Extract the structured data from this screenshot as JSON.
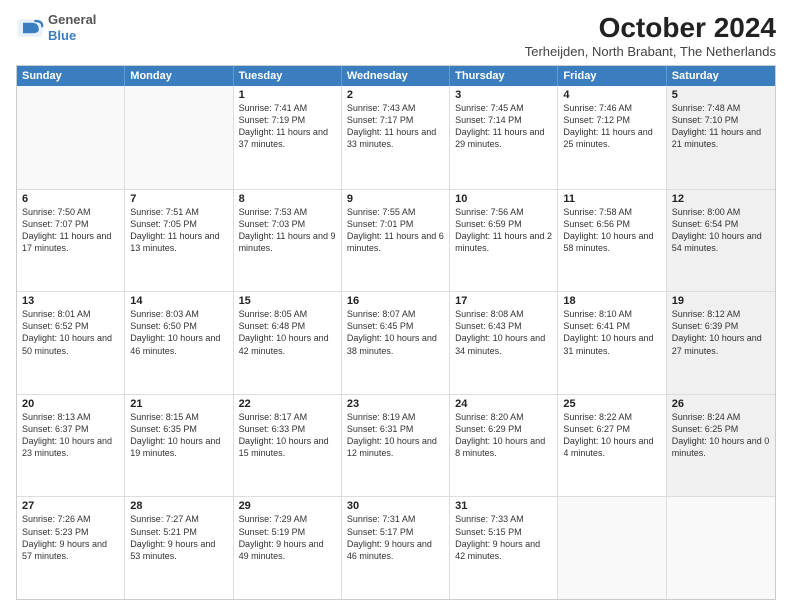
{
  "logo": {
    "line1": "General",
    "line2": "Blue"
  },
  "title": "October 2024",
  "subtitle": "Terheijden, North Brabant, The Netherlands",
  "header_days": [
    "Sunday",
    "Monday",
    "Tuesday",
    "Wednesday",
    "Thursday",
    "Friday",
    "Saturday"
  ],
  "weeks": [
    [
      {
        "day": "",
        "sunrise": "",
        "sunset": "",
        "daylight": "",
        "shaded": false,
        "empty": true
      },
      {
        "day": "",
        "sunrise": "",
        "sunset": "",
        "daylight": "",
        "shaded": false,
        "empty": true
      },
      {
        "day": "1",
        "sunrise": "Sunrise: 7:41 AM",
        "sunset": "Sunset: 7:19 PM",
        "daylight": "Daylight: 11 hours and 37 minutes.",
        "shaded": false,
        "empty": false
      },
      {
        "day": "2",
        "sunrise": "Sunrise: 7:43 AM",
        "sunset": "Sunset: 7:17 PM",
        "daylight": "Daylight: 11 hours and 33 minutes.",
        "shaded": false,
        "empty": false
      },
      {
        "day": "3",
        "sunrise": "Sunrise: 7:45 AM",
        "sunset": "Sunset: 7:14 PM",
        "daylight": "Daylight: 11 hours and 29 minutes.",
        "shaded": false,
        "empty": false
      },
      {
        "day": "4",
        "sunrise": "Sunrise: 7:46 AM",
        "sunset": "Sunset: 7:12 PM",
        "daylight": "Daylight: 11 hours and 25 minutes.",
        "shaded": false,
        "empty": false
      },
      {
        "day": "5",
        "sunrise": "Sunrise: 7:48 AM",
        "sunset": "Sunset: 7:10 PM",
        "daylight": "Daylight: 11 hours and 21 minutes.",
        "shaded": true,
        "empty": false
      }
    ],
    [
      {
        "day": "6",
        "sunrise": "Sunrise: 7:50 AM",
        "sunset": "Sunset: 7:07 PM",
        "daylight": "Daylight: 11 hours and 17 minutes.",
        "shaded": false,
        "empty": false
      },
      {
        "day": "7",
        "sunrise": "Sunrise: 7:51 AM",
        "sunset": "Sunset: 7:05 PM",
        "daylight": "Daylight: 11 hours and 13 minutes.",
        "shaded": false,
        "empty": false
      },
      {
        "day": "8",
        "sunrise": "Sunrise: 7:53 AM",
        "sunset": "Sunset: 7:03 PM",
        "daylight": "Daylight: 11 hours and 9 minutes.",
        "shaded": false,
        "empty": false
      },
      {
        "day": "9",
        "sunrise": "Sunrise: 7:55 AM",
        "sunset": "Sunset: 7:01 PM",
        "daylight": "Daylight: 11 hours and 6 minutes.",
        "shaded": false,
        "empty": false
      },
      {
        "day": "10",
        "sunrise": "Sunrise: 7:56 AM",
        "sunset": "Sunset: 6:59 PM",
        "daylight": "Daylight: 11 hours and 2 minutes.",
        "shaded": false,
        "empty": false
      },
      {
        "day": "11",
        "sunrise": "Sunrise: 7:58 AM",
        "sunset": "Sunset: 6:56 PM",
        "daylight": "Daylight: 10 hours and 58 minutes.",
        "shaded": false,
        "empty": false
      },
      {
        "day": "12",
        "sunrise": "Sunrise: 8:00 AM",
        "sunset": "Sunset: 6:54 PM",
        "daylight": "Daylight: 10 hours and 54 minutes.",
        "shaded": true,
        "empty": false
      }
    ],
    [
      {
        "day": "13",
        "sunrise": "Sunrise: 8:01 AM",
        "sunset": "Sunset: 6:52 PM",
        "daylight": "Daylight: 10 hours and 50 minutes.",
        "shaded": false,
        "empty": false
      },
      {
        "day": "14",
        "sunrise": "Sunrise: 8:03 AM",
        "sunset": "Sunset: 6:50 PM",
        "daylight": "Daylight: 10 hours and 46 minutes.",
        "shaded": false,
        "empty": false
      },
      {
        "day": "15",
        "sunrise": "Sunrise: 8:05 AM",
        "sunset": "Sunset: 6:48 PM",
        "daylight": "Daylight: 10 hours and 42 minutes.",
        "shaded": false,
        "empty": false
      },
      {
        "day": "16",
        "sunrise": "Sunrise: 8:07 AM",
        "sunset": "Sunset: 6:45 PM",
        "daylight": "Daylight: 10 hours and 38 minutes.",
        "shaded": false,
        "empty": false
      },
      {
        "day": "17",
        "sunrise": "Sunrise: 8:08 AM",
        "sunset": "Sunset: 6:43 PM",
        "daylight": "Daylight: 10 hours and 34 minutes.",
        "shaded": false,
        "empty": false
      },
      {
        "day": "18",
        "sunrise": "Sunrise: 8:10 AM",
        "sunset": "Sunset: 6:41 PM",
        "daylight": "Daylight: 10 hours and 31 minutes.",
        "shaded": false,
        "empty": false
      },
      {
        "day": "19",
        "sunrise": "Sunrise: 8:12 AM",
        "sunset": "Sunset: 6:39 PM",
        "daylight": "Daylight: 10 hours and 27 minutes.",
        "shaded": true,
        "empty": false
      }
    ],
    [
      {
        "day": "20",
        "sunrise": "Sunrise: 8:13 AM",
        "sunset": "Sunset: 6:37 PM",
        "daylight": "Daylight: 10 hours and 23 minutes.",
        "shaded": false,
        "empty": false
      },
      {
        "day": "21",
        "sunrise": "Sunrise: 8:15 AM",
        "sunset": "Sunset: 6:35 PM",
        "daylight": "Daylight: 10 hours and 19 minutes.",
        "shaded": false,
        "empty": false
      },
      {
        "day": "22",
        "sunrise": "Sunrise: 8:17 AM",
        "sunset": "Sunset: 6:33 PM",
        "daylight": "Daylight: 10 hours and 15 minutes.",
        "shaded": false,
        "empty": false
      },
      {
        "day": "23",
        "sunrise": "Sunrise: 8:19 AM",
        "sunset": "Sunset: 6:31 PM",
        "daylight": "Daylight: 10 hours and 12 minutes.",
        "shaded": false,
        "empty": false
      },
      {
        "day": "24",
        "sunrise": "Sunrise: 8:20 AM",
        "sunset": "Sunset: 6:29 PM",
        "daylight": "Daylight: 10 hours and 8 minutes.",
        "shaded": false,
        "empty": false
      },
      {
        "day": "25",
        "sunrise": "Sunrise: 8:22 AM",
        "sunset": "Sunset: 6:27 PM",
        "daylight": "Daylight: 10 hours and 4 minutes.",
        "shaded": false,
        "empty": false
      },
      {
        "day": "26",
        "sunrise": "Sunrise: 8:24 AM",
        "sunset": "Sunset: 6:25 PM",
        "daylight": "Daylight: 10 hours and 0 minutes.",
        "shaded": true,
        "empty": false
      }
    ],
    [
      {
        "day": "27",
        "sunrise": "Sunrise: 7:26 AM",
        "sunset": "Sunset: 5:23 PM",
        "daylight": "Daylight: 9 hours and 57 minutes.",
        "shaded": false,
        "empty": false
      },
      {
        "day": "28",
        "sunrise": "Sunrise: 7:27 AM",
        "sunset": "Sunset: 5:21 PM",
        "daylight": "Daylight: 9 hours and 53 minutes.",
        "shaded": false,
        "empty": false
      },
      {
        "day": "29",
        "sunrise": "Sunrise: 7:29 AM",
        "sunset": "Sunset: 5:19 PM",
        "daylight": "Daylight: 9 hours and 49 minutes.",
        "shaded": false,
        "empty": false
      },
      {
        "day": "30",
        "sunrise": "Sunrise: 7:31 AM",
        "sunset": "Sunset: 5:17 PM",
        "daylight": "Daylight: 9 hours and 46 minutes.",
        "shaded": false,
        "empty": false
      },
      {
        "day": "31",
        "sunrise": "Sunrise: 7:33 AM",
        "sunset": "Sunset: 5:15 PM",
        "daylight": "Daylight: 9 hours and 42 minutes.",
        "shaded": false,
        "empty": false
      },
      {
        "day": "",
        "sunrise": "",
        "sunset": "",
        "daylight": "",
        "shaded": false,
        "empty": true
      },
      {
        "day": "",
        "sunrise": "",
        "sunset": "",
        "daylight": "",
        "shaded": true,
        "empty": true
      }
    ]
  ]
}
